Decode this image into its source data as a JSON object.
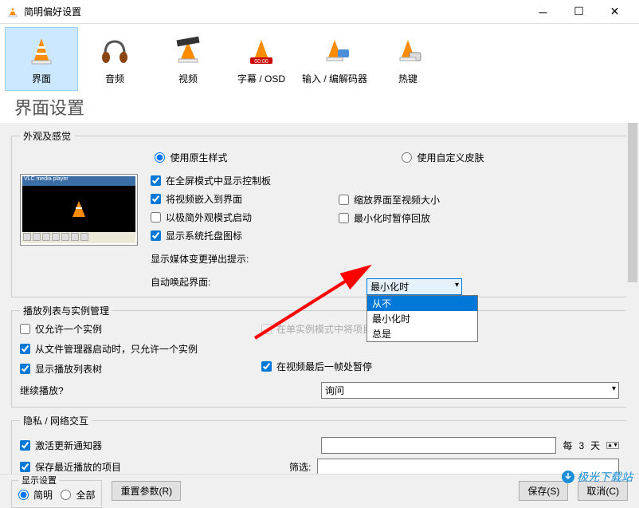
{
  "window": {
    "title": "简明偏好设置"
  },
  "tabs": [
    {
      "label": "界面"
    },
    {
      "label": "音频"
    },
    {
      "label": "视频"
    },
    {
      "label": "字幕 / OSD"
    },
    {
      "label": "输入 / 编解码器"
    },
    {
      "label": "热键"
    }
  ],
  "page_title": "界面设置",
  "appearance": {
    "legend": "外观及感觉",
    "radio_native": "使用原生样式",
    "radio_skin": "使用自定义皮肤",
    "chk_fullscreen_ctrl": "在全屏模式中显示控制板",
    "chk_embed_video": "将视频嵌入到界面",
    "chk_minimal": "以极简外观模式启动",
    "chk_systray": "显示系统托盘图标",
    "chk_resize": "缩放界面至视频大小",
    "chk_pause_min": "最小化时暂停回放",
    "label_media_change": "显示媒体变更弹出提示:",
    "label_auto_raise": "自动唤起界面:",
    "select_media_change": "最小化时",
    "dropdown_options": [
      "从不",
      "最小化时",
      "总是"
    ]
  },
  "playlist": {
    "legend": "播放列表与实例管理",
    "chk_one_instance": "仅允许一个实例",
    "chk_enqueue": "在单实例模式中将项目添加到播放列表队列中",
    "chk_one_from_fm": "从文件管理器启动时，只允许一个实例",
    "chk_show_tree": "显示播放列表树",
    "chk_last_frame": "在视频最后一帧处暂停",
    "label_continue": "继续播放?",
    "select_continue": "询问"
  },
  "privacy": {
    "legend": "隐私 / 网络交互",
    "chk_update": "激活更新通知器",
    "every_label": "每",
    "days_value": "3",
    "days_unit": "天",
    "chk_recent": "保存最近播放的项目",
    "filter_label": "筛选:"
  },
  "display_settings": {
    "legend": "显示设置",
    "radio_simple": "简明",
    "radio_all": "全部",
    "reset_btn": "重置参数(R)"
  },
  "buttons": {
    "save": "保存(S)",
    "cancel": "取消(C)"
  },
  "watermark": "极光下载站"
}
